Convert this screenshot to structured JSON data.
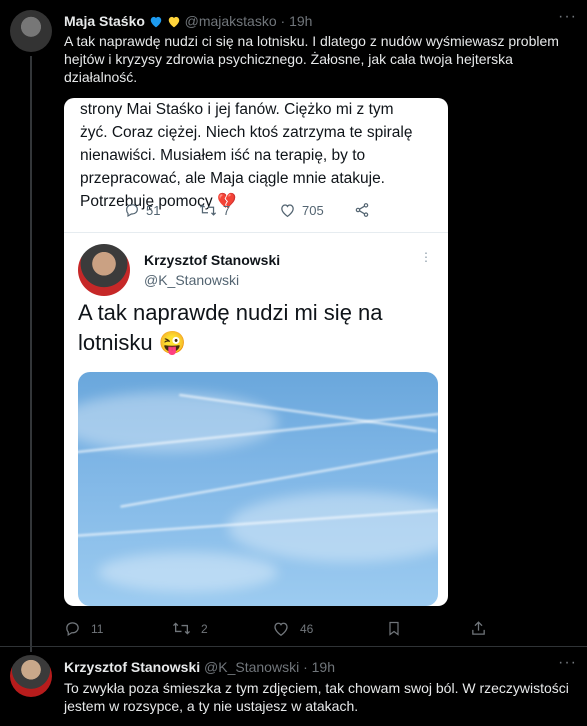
{
  "colors": {
    "background": "#000000",
    "text": "#e7e9ea",
    "muted": "#71767b",
    "blue_heart": "#1d9bf0",
    "yellow_heart": "#ffd43b"
  },
  "tweet1": {
    "name": "Maja Staśko",
    "handle": "@majakstasko",
    "dot": "·",
    "time": "19h",
    "text": "A tak naprawdę nudzi ci się na lotnisku. I dlatego z nudów wyśmiewasz problem hejtów i kryzysy zdrowia psychicznego. Żałosne, jak cała twoja hejterska działalność.",
    "replies": "11",
    "retweets": "2",
    "likes": "46",
    "icons": [
      "reply-icon",
      "retweet-icon",
      "like-icon",
      "share-icon"
    ]
  },
  "screenshot": {
    "quoted_text": "strony Mai Staśko i jej fanów. Ciężko mi z tym żyć. Coraz ciężej. Niech ktoś zatrzyma te spiralę nienawiści. Musiałem iść na terapię, by to przepracować, ale Maja ciągle mnie atakuje. Potrzebuję pomocy 💔",
    "quoted_replies": "51",
    "quoted_retweets": "7",
    "quoted_likes": "705",
    "author_name": "Krzysztof Stanowski",
    "author_handle": "@K_Stanowski",
    "body": "A tak naprawdę nudzi mi się na lotnisku 😜"
  },
  "tweet2": {
    "name": "Krzysztof Stanowski",
    "handle": "@K_Stanowski",
    "dot": "·",
    "time": "19h",
    "text": "To zwykła poza śmieszka z tym zdjęciem, tak chowam swoj ból. W rzeczywistości jestem w rozsypce, a ty nie ustajesz w atakach."
  }
}
